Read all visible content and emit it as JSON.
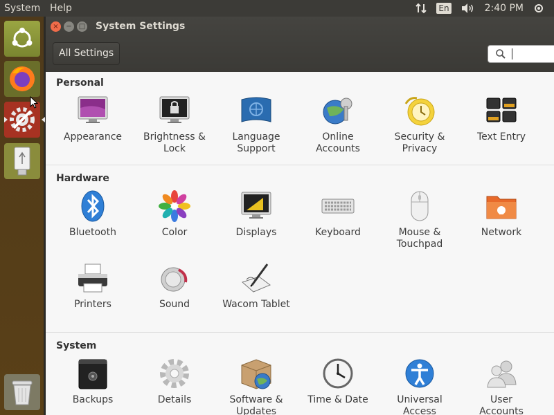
{
  "top_panel": {
    "app_menu": "System",
    "help_menu": "Help",
    "keyboard_layout": "En",
    "clock": "2:40 PM"
  },
  "window": {
    "title": "System Settings",
    "all_settings_label": "All Settings",
    "search": {
      "value": "",
      "placeholder": ""
    }
  },
  "sections": {
    "personal": "Personal",
    "hardware": "Hardware",
    "system": "System"
  },
  "items": {
    "appearance": "Appearance",
    "brightness_l1": "Brightness &",
    "brightness_l2": "Lock",
    "language_l1": "Language",
    "language_l2": "Support",
    "online_l1": "Online",
    "online_l2": "Accounts",
    "security_l1": "Security &",
    "security_l2": "Privacy",
    "text_entry": "Text Entry",
    "bluetooth": "Bluetooth",
    "color": "Color",
    "displays": "Displays",
    "keyboard": "Keyboard",
    "mouse_l1": "Mouse &",
    "mouse_l2": "Touchpad",
    "network": "Network",
    "printers": "Printers",
    "sound": "Sound",
    "wacom": "Wacom Tablet",
    "backups": "Backups",
    "details": "Details",
    "software_l1": "Software &",
    "software_l2": "Updates",
    "time_date": "Time & Date",
    "universal_l1": "Universal",
    "universal_l2": "Access",
    "user_l1": "User",
    "user_l2": "Accounts"
  },
  "colors": {
    "panel": "#3c3b37",
    "launcher": "#5a4017",
    "close_button": "#f06c4a",
    "content_bg": "#f7f7f7"
  }
}
